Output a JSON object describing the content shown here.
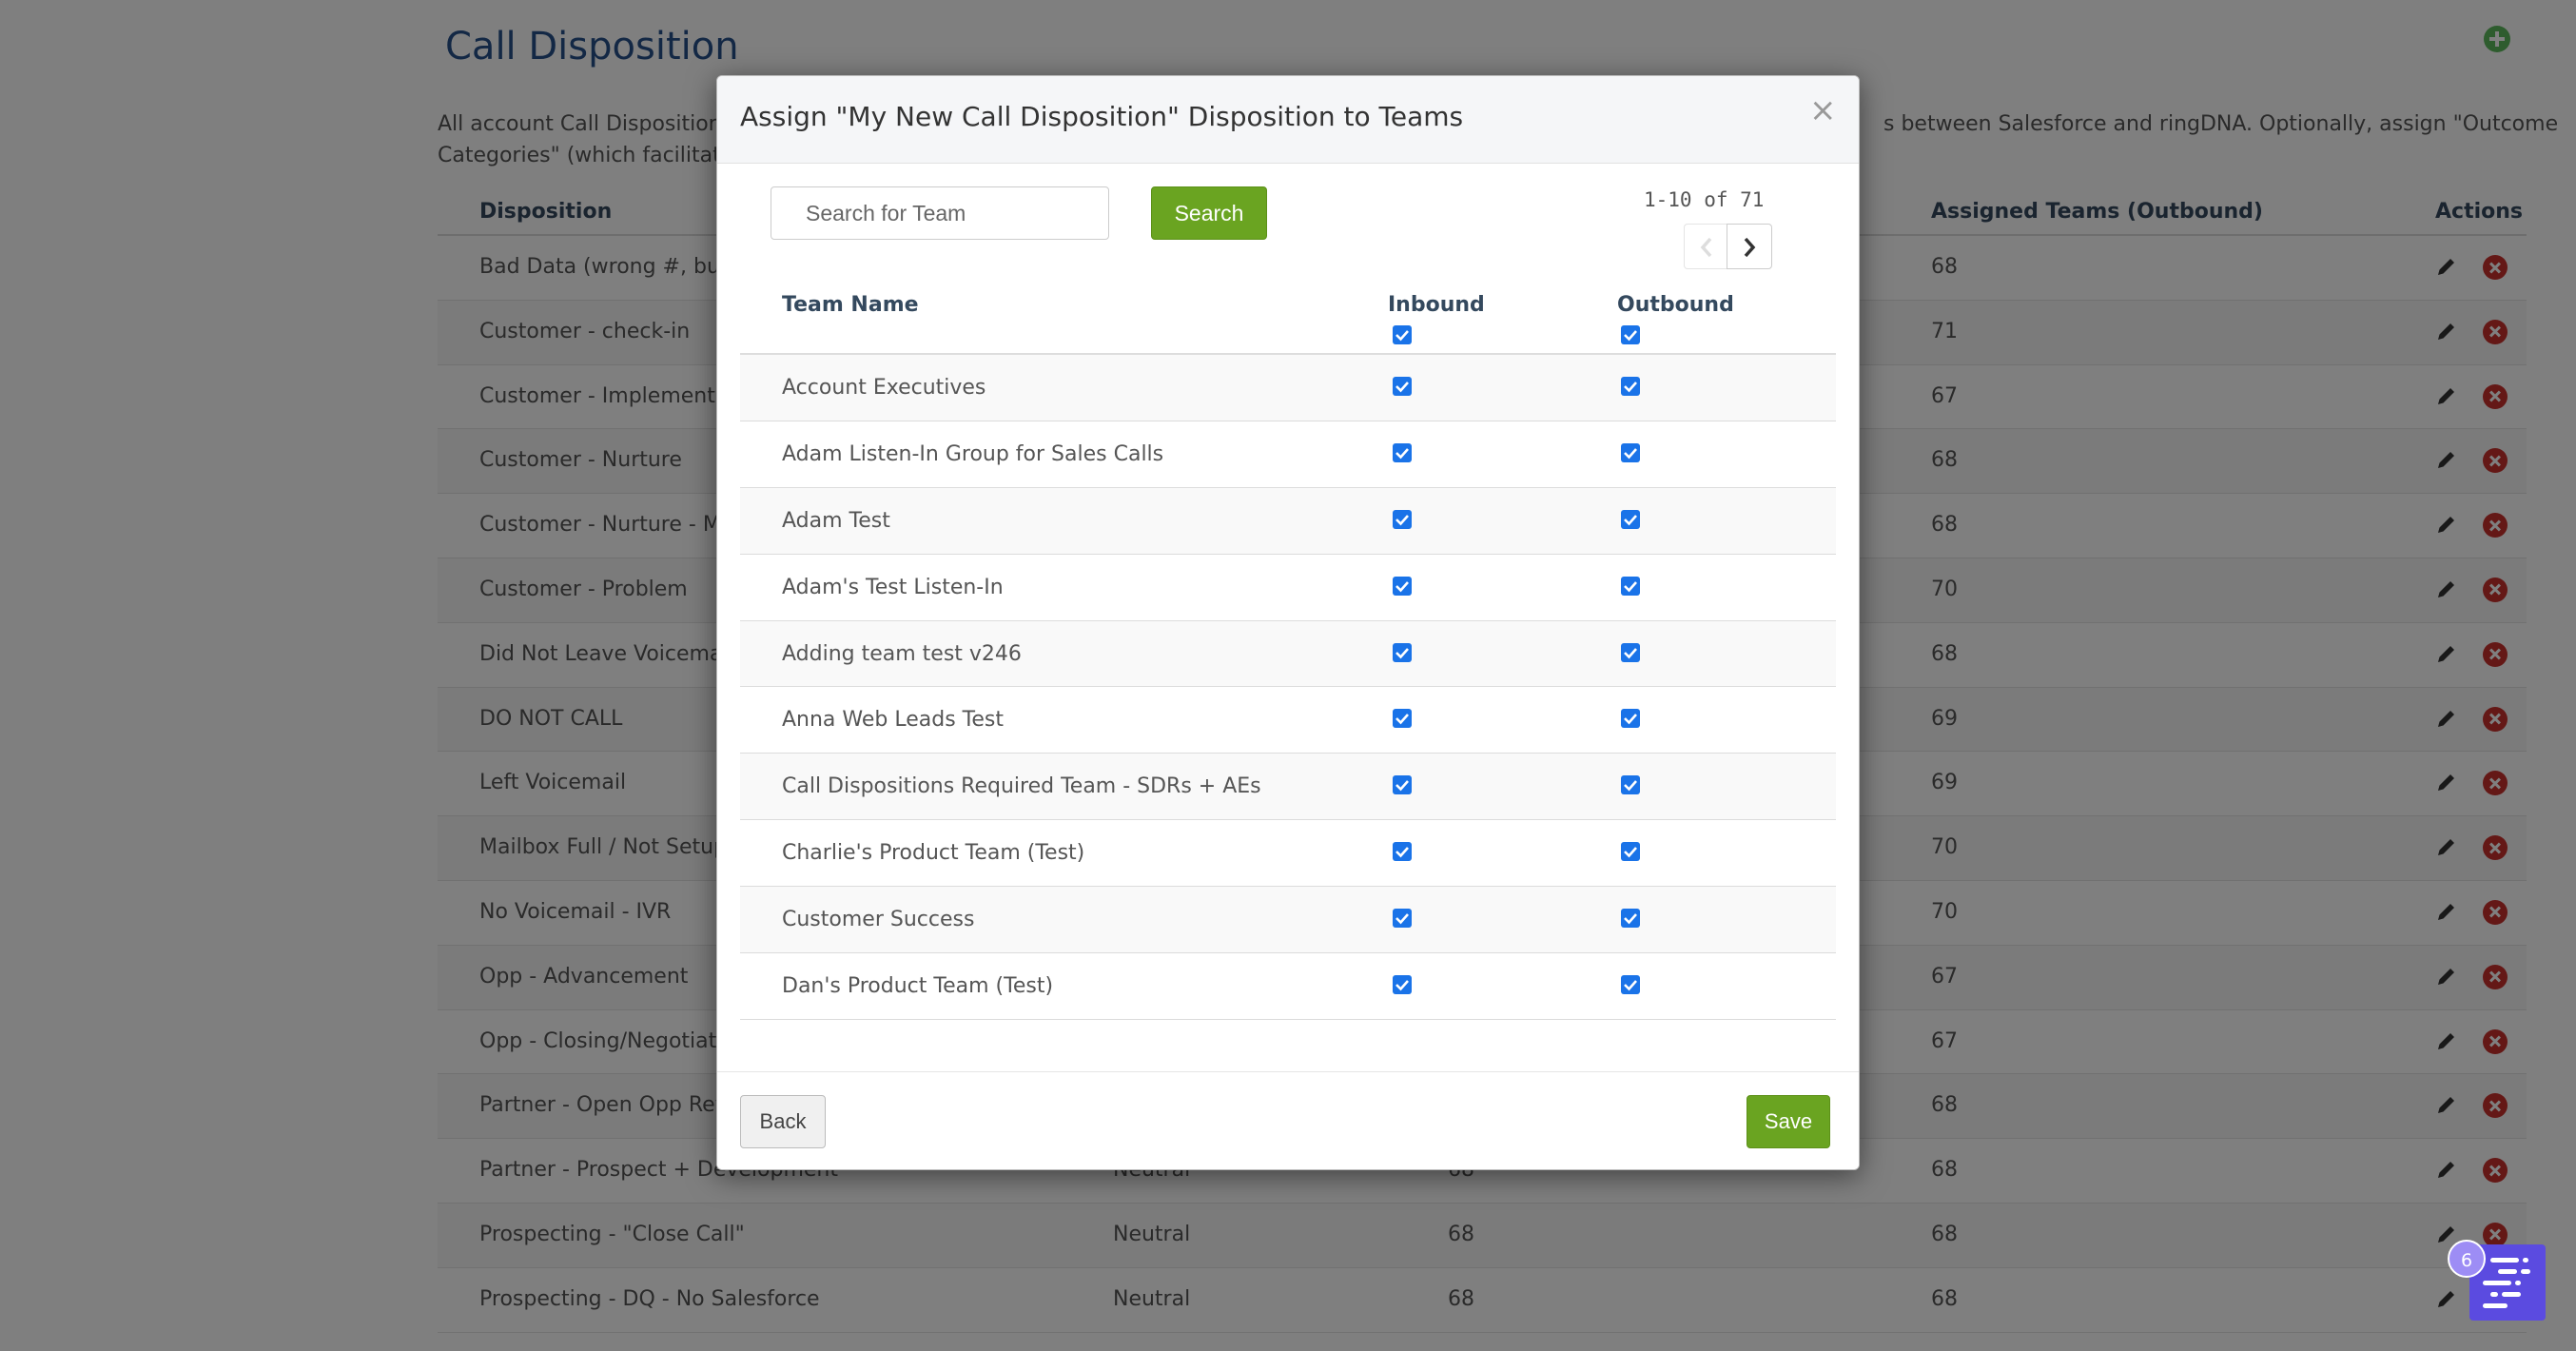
{
  "page": {
    "title": "Call Disposition",
    "intro_line1": "All account Call Dispositions a",
    "intro_line1_rest": "s between Salesforce and ringDNA. Optionally, assign \"Outcome",
    "intro_line2": "Categories\" (which facilitate re",
    "table": {
      "headers": [
        "Disposition",
        "Assigned Teams (Outbound)",
        "Actions"
      ],
      "rows": [
        {
          "disposition": "Bad Data (wrong #, busy)",
          "category": "",
          "inbound": "",
          "outbound": "68"
        },
        {
          "disposition": "Customer - check-in",
          "category": "",
          "inbound": "",
          "outbound": "71"
        },
        {
          "disposition": "Customer - Implementati",
          "category": "",
          "inbound": "",
          "outbound": "67"
        },
        {
          "disposition": "Customer - Nurture",
          "category": "",
          "inbound": "",
          "outbound": "68"
        },
        {
          "disposition": "Customer - Nurture - Mee",
          "category": "",
          "inbound": "",
          "outbound": "68"
        },
        {
          "disposition": "Customer - Problem",
          "category": "",
          "inbound": "",
          "outbound": "70"
        },
        {
          "disposition": "Did Not Leave Voicemail",
          "category": "",
          "inbound": "",
          "outbound": "68"
        },
        {
          "disposition": "DO NOT CALL",
          "category": "",
          "inbound": "",
          "outbound": "69"
        },
        {
          "disposition": "Left Voicemail",
          "category": "",
          "inbound": "",
          "outbound": "69"
        },
        {
          "disposition": "Mailbox Full / Not Setup Y",
          "category": "",
          "inbound": "",
          "outbound": "70"
        },
        {
          "disposition": "No Voicemail - IVR",
          "category": "",
          "inbound": "",
          "outbound": "70"
        },
        {
          "disposition": "Opp - Advancement",
          "category": "",
          "inbound": "",
          "outbound": "67"
        },
        {
          "disposition": "Opp - Closing/Negotiation",
          "category": "",
          "inbound": "",
          "outbound": "67"
        },
        {
          "disposition": "Partner - Open Opp Revie",
          "category": "",
          "inbound": "",
          "outbound": "68"
        },
        {
          "disposition": "Partner - Prospect + Development",
          "category": "Neutral",
          "inbound": "68",
          "outbound": "68"
        },
        {
          "disposition": "Prospecting - \"Close Call\"",
          "category": "Neutral",
          "inbound": "68",
          "outbound": "68"
        },
        {
          "disposition": "Prospecting - DQ - No Salesforce",
          "category": "Neutral",
          "inbound": "68",
          "outbound": "68"
        }
      ]
    }
  },
  "modal": {
    "title": "Assign \"My New Call Disposition\" Disposition to Teams",
    "close_label": "×",
    "search": {
      "placeholder": "Search for Team",
      "button_label": "Search"
    },
    "pager": {
      "text": "1-10 of 71"
    },
    "columns": {
      "name": "Team Name",
      "inbound": "Inbound",
      "outbound": "Outbound"
    },
    "teams": [
      {
        "name": "Account Executives",
        "inbound": true,
        "outbound": true
      },
      {
        "name": "Adam Listen-In Group for Sales Calls",
        "inbound": true,
        "outbound": true
      },
      {
        "name": "Adam Test",
        "inbound": true,
        "outbound": true
      },
      {
        "name": "Adam's Test Listen-In",
        "inbound": true,
        "outbound": true
      },
      {
        "name": "Adding team test v246",
        "inbound": true,
        "outbound": true
      },
      {
        "name": "Anna Web Leads Test",
        "inbound": true,
        "outbound": true
      },
      {
        "name": "Call Dispositions Required Team - SDRs + AEs",
        "inbound": true,
        "outbound": true
      },
      {
        "name": "Charlie's Product Team (Test)",
        "inbound": true,
        "outbound": true
      },
      {
        "name": "Customer Success",
        "inbound": true,
        "outbound": true
      },
      {
        "name": "Dan's Product Team (Test)",
        "inbound": true,
        "outbound": true
      }
    ],
    "footer": {
      "back_label": "Back",
      "save_label": "Save"
    }
  },
  "widget": {
    "badge_count": "6",
    "icon": "chat-widget-icon"
  },
  "colors": {
    "accent_green": "#6aa421",
    "title_blue": "#27508a",
    "checkbox_blue": "#1a73e8",
    "delete_red": "#c9302c",
    "widget_purple": "#5b4be0"
  }
}
